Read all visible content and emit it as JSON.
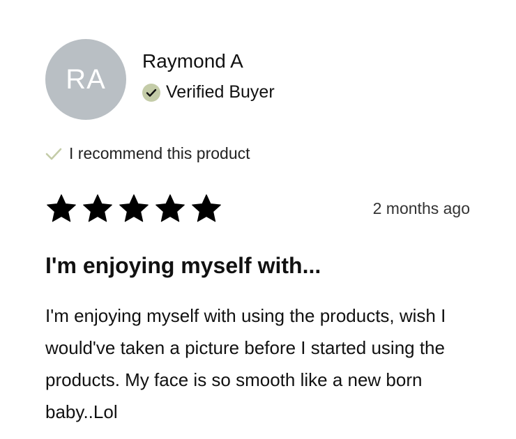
{
  "reviewer": {
    "initials": "RA",
    "name": "Raymond A",
    "badge": "Verified Buyer"
  },
  "recommendation": "I recommend this product",
  "rating": {
    "value": 5,
    "max": 5
  },
  "timestamp": "2 months ago",
  "review": {
    "title": "I'm enjoying myself with...",
    "body": "I'm enjoying myself with using the products, wish I would've taken a picture before I started using the products. My face is so smooth like a new born baby..Lol"
  },
  "colors": {
    "avatar_bg": "#b9bfc4",
    "verified_badge_bg": "#c4cca8",
    "recommend_check": "#c4cca8",
    "star_fill": "#000000"
  },
  "icons": {
    "verified": "check-circle-icon",
    "recommend": "check-icon",
    "rating": "star-icon"
  }
}
